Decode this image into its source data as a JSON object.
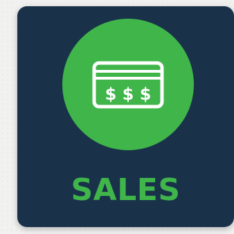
{
  "card": {
    "label": "SALES",
    "background_color": "#19324a",
    "accent_color": "#3fb54a"
  },
  "icon": {
    "name": "credit-card-icon",
    "symbols": "$ $ $"
  }
}
